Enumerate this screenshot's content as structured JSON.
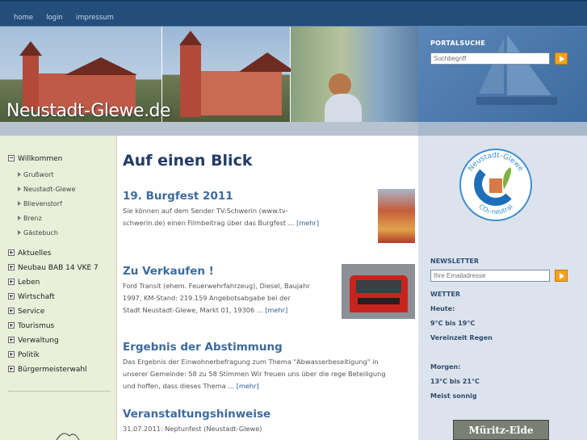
{
  "nav": {
    "home": "home",
    "login": "login",
    "impressum": "impressum"
  },
  "header": {
    "site_name": "Neustadt-Glewe.de"
  },
  "search": {
    "title": "PORTALSUCHE",
    "placeholder": "Suchbegriff"
  },
  "sidebar": {
    "top": "Willkommen",
    "subs": [
      "Grußwort",
      "Neustadt-Glewe",
      "Blievenstorf",
      "Brenz",
      "Gästebuch"
    ],
    "items": [
      "Aktuelles",
      "Neubau BAB 14 VKE 7",
      "Leben",
      "Wirtschaft",
      "Service",
      "Tourismus",
      "Verwaltung",
      "Politik",
      "Bürgermeisterwahl"
    ]
  },
  "main": {
    "heading": "Auf einen Blick",
    "articles": [
      {
        "title": "19. Burgfest 2011",
        "line1": "Sie können auf dem Sender TV:Schwerin (www.tv-",
        "line2": "schwerin.de) einen Filmbeitrag über das Burgfest ... ",
        "more": "[mehr]"
      },
      {
        "title": "Zu Verkaufen !",
        "line1": "Ford Transit  (ehem. Feuerwehrfahrzeug), Diesel, Baujahr",
        "line2": "1997, KM-Stand:   219.159    Angebotsabgabe bei der",
        "line3": "Stadt Neustadt-Glewe, Markt 01, 19306 ... ",
        "more": "[mehr]"
      },
      {
        "title": "Ergebnis der Abstimmung",
        "line1": "Das Ergebnis der Einwohnerbefragung zum Thema \"Abwasserbeseitigung\" in",
        "line2": "unserer Gemeinde:   58 zu 58 Stimmen   Wir freuen uns über die rege Beteiligung",
        "line3": "und hoffen, dass dieses Thema ... ",
        "more": "[mehr]"
      },
      {
        "title": "Veranstaltungshinweise",
        "line1": "31.07.2011:        Neptunfest (Neustadt-Glewe)"
      }
    ]
  },
  "right": {
    "logo_top": "Neustadt-Glewe",
    "logo_bottom": "CO₂-neutral",
    "newsletter_title": "NEWSLETTER",
    "newsletter_placeholder": "Ihre Emailadresse",
    "weather_title": "WETTER",
    "today_label": "Heute:",
    "today_temp": "9°C bis 19°C",
    "today_desc": "Vereinzelt Regen",
    "tomorrow_label": "Morgen:",
    "tomorrow_temp": "13°C bis 21°C",
    "tomorrow_desc": "Meist sonnig",
    "banner_text": "Müritz-Elde"
  },
  "colors": {
    "accent": "#3d6b9e",
    "topbar": "#234d7b",
    "button": "#f4a21d",
    "sidebar_bg": "#e9efd9"
  }
}
